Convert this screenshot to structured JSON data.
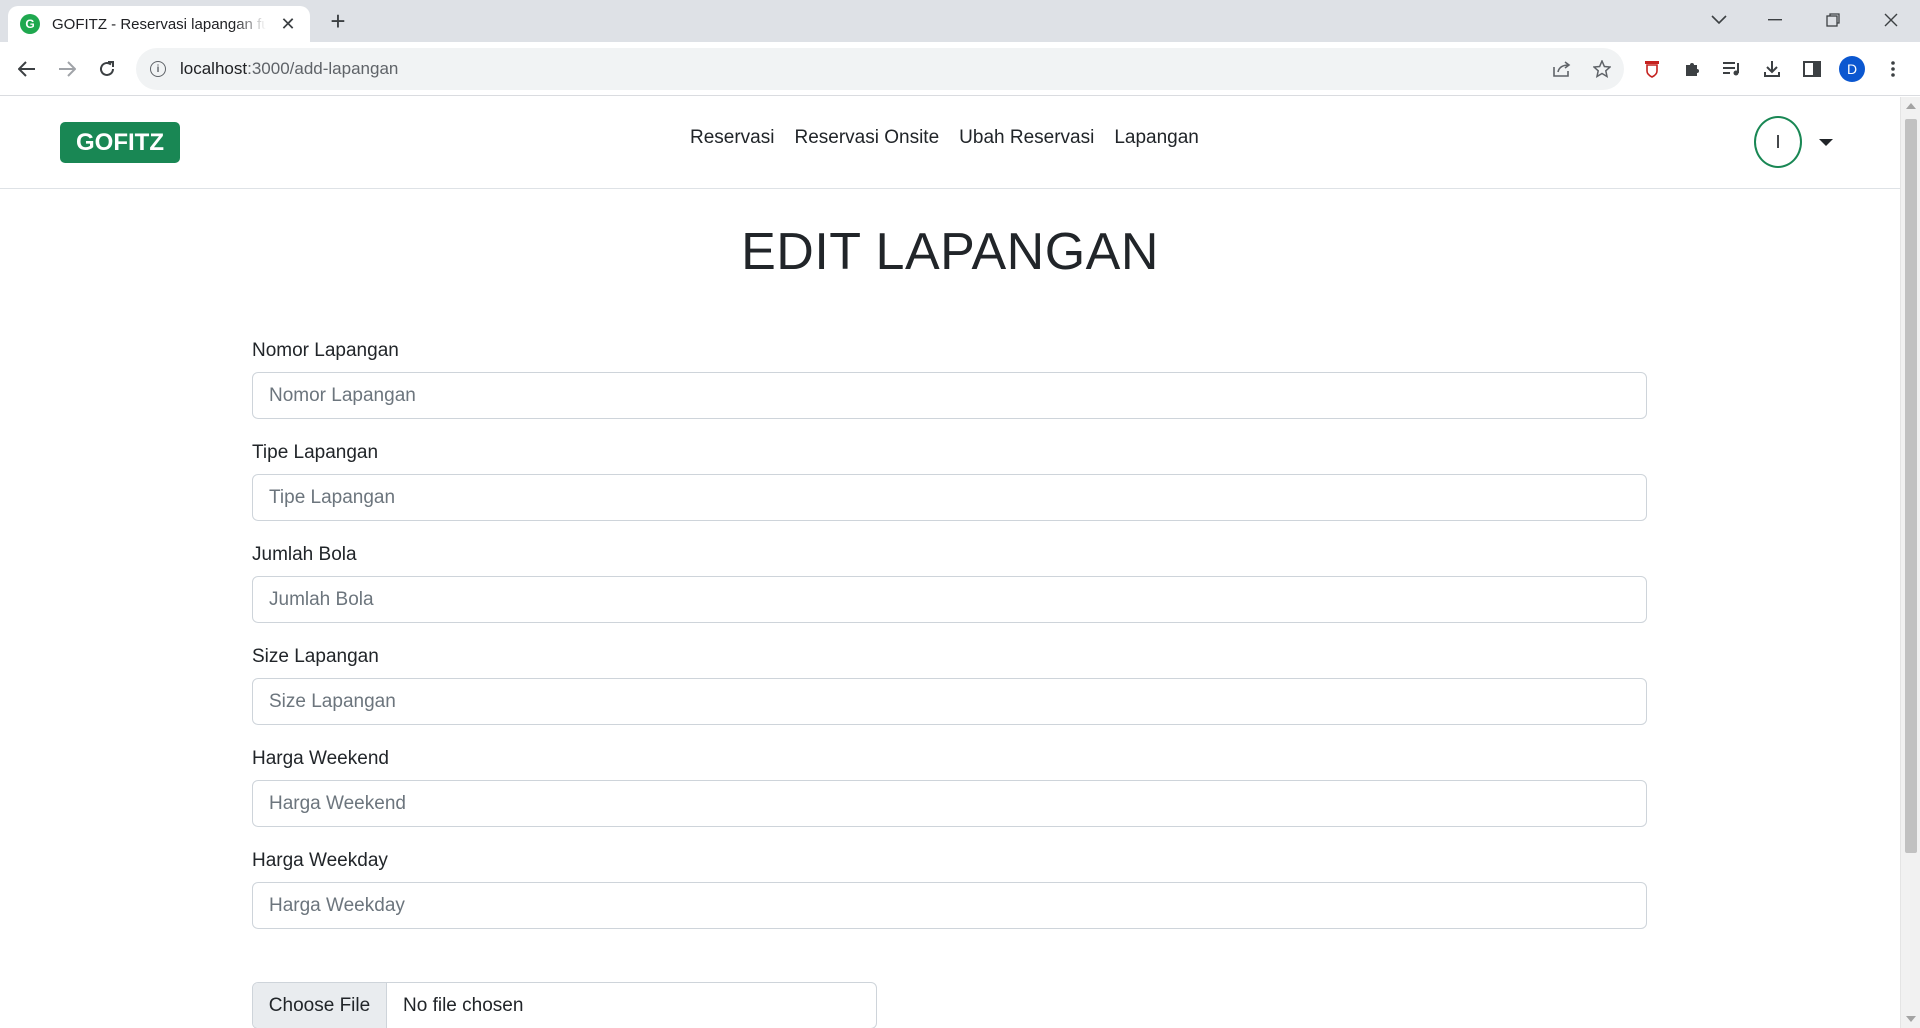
{
  "browser": {
    "tab_title": "GOFITZ - Reservasi lapangan futsal",
    "favicon_letter": "G",
    "new_tab_symbol": "+",
    "url_host": "localhost",
    "url_rest": ":3000/add-lapangan",
    "profile_initial": "D",
    "accent": "#1fa84f"
  },
  "app": {
    "brand": "GOFITZ",
    "brand_color": "#198754",
    "nav": [
      {
        "label": "Reservasi"
      },
      {
        "label": "Reservasi Onsite"
      },
      {
        "label": "Ubah Reservasi"
      },
      {
        "label": "Lapangan"
      }
    ],
    "avatar_initial": "I"
  },
  "form": {
    "title": "EDIT LAPANGAN",
    "fields": [
      {
        "label": "Nomor Lapangan",
        "placeholder": "Nomor Lapangan",
        "value": ""
      },
      {
        "label": "Tipe Lapangan",
        "placeholder": "Tipe Lapangan",
        "value": ""
      },
      {
        "label": "Jumlah Bola",
        "placeholder": "Jumlah Bola",
        "value": ""
      },
      {
        "label": "Size Lapangan",
        "placeholder": "Size Lapangan",
        "value": ""
      },
      {
        "label": "Harga Weekend",
        "placeholder": "Harga Weekend",
        "value": ""
      },
      {
        "label": "Harga Weekday",
        "placeholder": "Harga Weekday",
        "value": ""
      }
    ],
    "file": {
      "button_label": "Choose File",
      "status": "No file chosen"
    }
  }
}
